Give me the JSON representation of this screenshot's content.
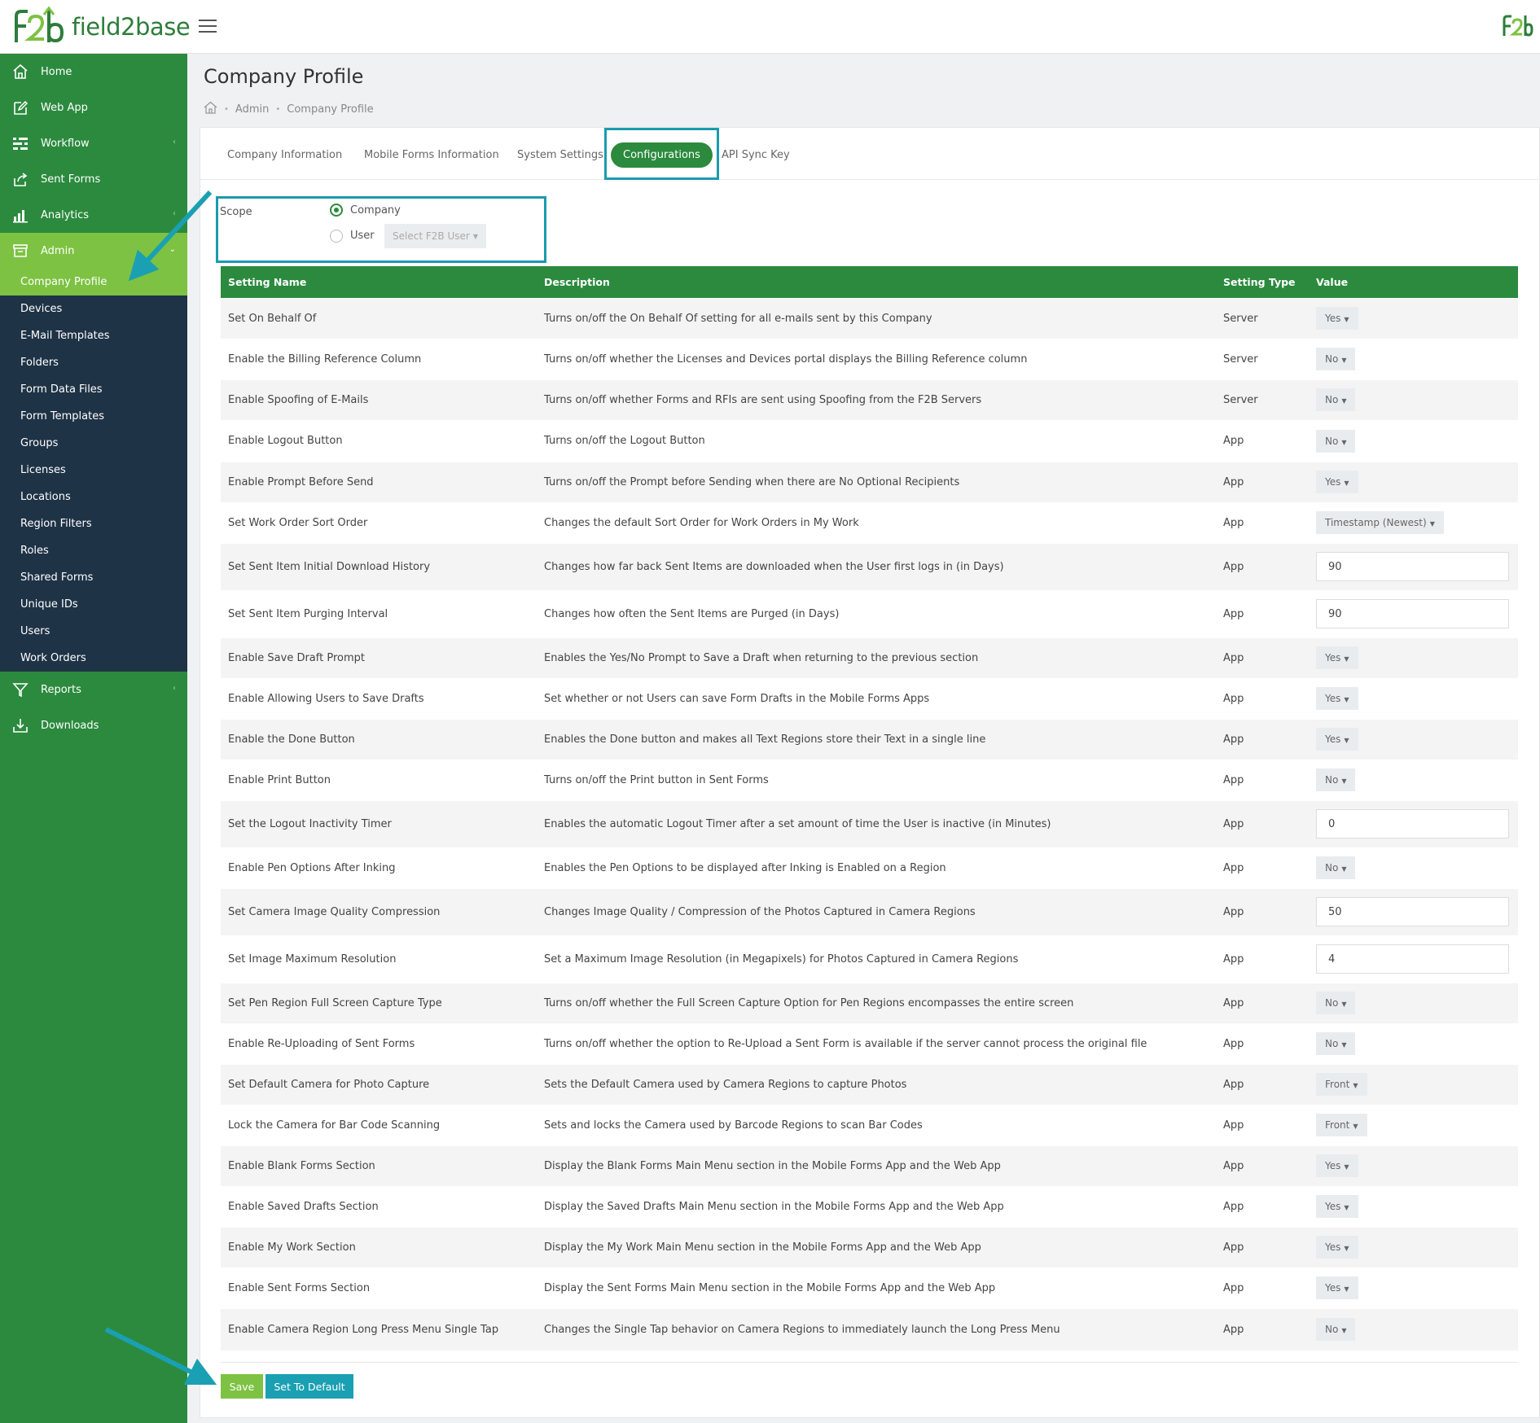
{
  "brand": {
    "name": "field2base"
  },
  "sidebar": {
    "items": [
      {
        "label": "Home"
      },
      {
        "label": "Web App"
      },
      {
        "label": "Workflow"
      },
      {
        "label": "Sent Forms"
      },
      {
        "label": "Analytics"
      },
      {
        "label": "Admin"
      }
    ],
    "admin_sub": [
      {
        "label": "Company Profile"
      },
      {
        "label": "Devices"
      },
      {
        "label": "E-Mail Templates"
      },
      {
        "label": "Folders"
      },
      {
        "label": "Form Data Files"
      },
      {
        "label": "Form Templates"
      },
      {
        "label": "Groups"
      },
      {
        "label": "Licenses"
      },
      {
        "label": "Locations"
      },
      {
        "label": "Region Filters"
      },
      {
        "label": "Roles"
      },
      {
        "label": "Shared Forms"
      },
      {
        "label": "Unique IDs"
      },
      {
        "label": "Users"
      },
      {
        "label": "Work Orders"
      }
    ],
    "bottom_items": [
      {
        "label": "Reports"
      },
      {
        "label": "Downloads"
      }
    ]
  },
  "page": {
    "title": "Company Profile",
    "breadcrumb": [
      "Admin",
      "Company Profile"
    ]
  },
  "tabs": [
    {
      "label": "Company Information"
    },
    {
      "label": "Mobile Forms Information"
    },
    {
      "label": "System Settings"
    },
    {
      "label": "Configurations"
    },
    {
      "label": "API Sync Key"
    }
  ],
  "scope": {
    "label": "Scope",
    "company_label": "Company",
    "user_label": "User",
    "user_select": "Select F2B User"
  },
  "table": {
    "headers": [
      "Setting Name",
      "Description",
      "Setting Type",
      "Value"
    ],
    "rows": [
      {
        "name": "Set On Behalf Of",
        "desc": "Turns on/off the On Behalf Of setting for all e-mails sent by this Company",
        "type": "Server",
        "value": "Yes",
        "kind": "dropdown"
      },
      {
        "name": "Enable the Billing Reference Column",
        "desc": "Turns on/off whether the Licenses and Devices portal displays the Billing Reference column",
        "type": "Server",
        "value": "No",
        "kind": "dropdown"
      },
      {
        "name": "Enable Spoofing of E-Mails",
        "desc": "Turns on/off whether Forms and RFIs are sent using Spoofing from the F2B Servers",
        "type": "Server",
        "value": "No",
        "kind": "dropdown"
      },
      {
        "name": "Enable Logout Button",
        "desc": "Turns on/off the Logout Button",
        "type": "App",
        "value": "No",
        "kind": "dropdown"
      },
      {
        "name": "Enable Prompt Before Send",
        "desc": "Turns on/off the Prompt before Sending when there are No Optional Recipients",
        "type": "App",
        "value": "Yes",
        "kind": "dropdown"
      },
      {
        "name": "Set Work Order Sort Order",
        "desc": "Changes the default Sort Order for Work Orders in My Work",
        "type": "App",
        "value": "Timestamp (Newest)",
        "kind": "dropdown"
      },
      {
        "name": "Set Sent Item Initial Download History",
        "desc": "Changes how far back Sent Items are downloaded when the User first logs in (in Days)",
        "type": "App",
        "value": "90",
        "kind": "input"
      },
      {
        "name": "Set Sent Item Purging Interval",
        "desc": "Changes how often the Sent Items are Purged (in Days)",
        "type": "App",
        "value": "90",
        "kind": "input"
      },
      {
        "name": "Enable Save Draft Prompt",
        "desc": "Enables the Yes/No Prompt to Save a Draft when returning to the previous section",
        "type": "App",
        "value": "Yes",
        "kind": "dropdown"
      },
      {
        "name": "Enable Allowing Users to Save Drafts",
        "desc": "Set whether or not Users can save Form Drafts in the Mobile Forms Apps",
        "type": "App",
        "value": "Yes",
        "kind": "dropdown"
      },
      {
        "name": "Enable the Done Button",
        "desc": "Enables the Done button and makes all Text Regions store their Text in a single line",
        "type": "App",
        "value": "Yes",
        "kind": "dropdown"
      },
      {
        "name": "Enable Print Button",
        "desc": "Turns on/off the Print button in Sent Forms",
        "type": "App",
        "value": "No",
        "kind": "dropdown"
      },
      {
        "name": "Set the Logout Inactivity Timer",
        "desc": "Enables the automatic Logout Timer after a set amount of time the User is inactive (in Minutes)",
        "type": "App",
        "value": "0",
        "kind": "input"
      },
      {
        "name": "Enable Pen Options After Inking",
        "desc": "Enables the Pen Options to be displayed after Inking is Enabled on a Region",
        "type": "App",
        "value": "No",
        "kind": "dropdown"
      },
      {
        "name": "Set Camera Image Quality Compression",
        "desc": "Changes Image Quality / Compression of the Photos Captured in Camera Regions",
        "type": "App",
        "value": "50",
        "kind": "input"
      },
      {
        "name": "Set Image Maximum Resolution",
        "desc": "Set a Maximum Image Resolution (in Megapixels) for Photos Captured in Camera Regions",
        "type": "App",
        "value": "4",
        "kind": "input"
      },
      {
        "name": "Set Pen Region Full Screen Capture Type",
        "desc": "Turns on/off whether the Full Screen Capture Option for Pen Regions encompasses the entire screen",
        "type": "App",
        "value": "No",
        "kind": "dropdown"
      },
      {
        "name": "Enable Re-Uploading of Sent Forms",
        "desc": "Turns on/off whether the option to Re-Upload a Sent Form is available if the server cannot process the original file",
        "type": "App",
        "value": "No",
        "kind": "dropdown"
      },
      {
        "name": "Set Default Camera for Photo Capture",
        "desc": "Sets the Default Camera used by Camera Regions to capture Photos",
        "type": "App",
        "value": "Front",
        "kind": "dropdown"
      },
      {
        "name": "Lock the Camera for Bar Code Scanning",
        "desc": "Sets and locks the Camera used by Barcode Regions to scan Bar Codes",
        "type": "App",
        "value": "Front",
        "kind": "dropdown"
      },
      {
        "name": "Enable Blank Forms Section",
        "desc": "Display the Blank Forms Main Menu section in the Mobile Forms App and the Web App",
        "type": "App",
        "value": "Yes",
        "kind": "dropdown"
      },
      {
        "name": "Enable Saved Drafts Section",
        "desc": "Display the Saved Drafts Main Menu section in the Mobile Forms App and the Web App",
        "type": "App",
        "value": "Yes",
        "kind": "dropdown"
      },
      {
        "name": "Enable My Work Section",
        "desc": "Display the My Work Main Menu section in the Mobile Forms App and the Web App",
        "type": "App",
        "value": "Yes",
        "kind": "dropdown"
      },
      {
        "name": "Enable Sent Forms Section",
        "desc": "Display the Sent Forms Main Menu section in the Mobile Forms App and the Web App",
        "type": "App",
        "value": "Yes",
        "kind": "dropdown"
      },
      {
        "name": "Enable Camera Region Long Press Menu Single Tap",
        "desc": "Changes the Single Tap behavior on Camera Regions to immediately launch the Long Press Menu",
        "type": "App",
        "value": "No",
        "kind": "dropdown"
      }
    ]
  },
  "actions": {
    "save": "Save",
    "set_default": "Set To Default"
  },
  "colors": {
    "primary_green": "#2b8a3e",
    "light_green": "#7dc242",
    "teal": "#1aa0b2",
    "submenu_bg": "#1f3346"
  }
}
